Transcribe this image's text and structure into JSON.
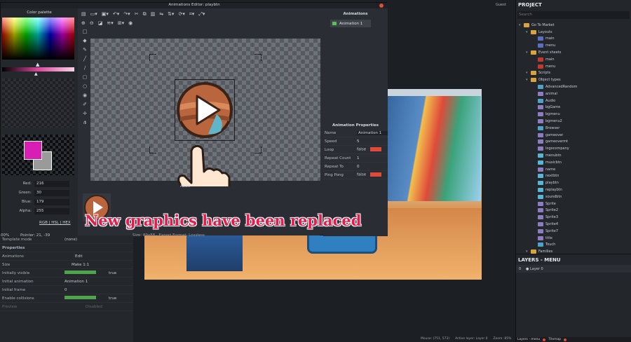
{
  "anim_editor": {
    "title": "Animations Editor: playbtn",
    "color_palette_title": "Color palette",
    "rgba": [
      {
        "label": "Red:",
        "value": "216"
      },
      {
        "label": "Green:",
        "value": "30"
      },
      {
        "label": "Blue:",
        "value": "179"
      },
      {
        "label": "Alpha:",
        "value": "255"
      }
    ],
    "color_modes": "RGB | HSL | HEX",
    "zoom_status": "00%",
    "pointer": "Pointer: 21, -39",
    "size_status": "Size: 89x88 · Export Format: Lossless",
    "frames_label": "Anim",
    "animations_title": "Animations",
    "animation_item": "Animation 1",
    "props_title": "Animation Properties",
    "props": [
      {
        "label": "Name",
        "value": "Animation 1"
      },
      {
        "label": "Speed",
        "value": "5"
      },
      {
        "label": "Loop",
        "value": "false"
      },
      {
        "label": "Repeat Count",
        "value": "1"
      },
      {
        "label": "Repeat To",
        "value": "0"
      },
      {
        "label": "Ping Pong",
        "value": "false"
      }
    ],
    "close_label": "×"
  },
  "caption": "New graphics have been replaced",
  "project": {
    "title": "PROJECT",
    "search_placeholder": "Search",
    "tree": [
      {
        "label": "Go To Market",
        "depth": 0,
        "type": "folder"
      },
      {
        "label": "Layouts",
        "depth": 1,
        "type": "folder"
      },
      {
        "label": "main",
        "depth": 2,
        "type": "layout"
      },
      {
        "label": "menu",
        "depth": 2,
        "type": "layout"
      },
      {
        "label": "Event sheets",
        "depth": 1,
        "type": "folder"
      },
      {
        "label": "main",
        "depth": 2,
        "type": "events"
      },
      {
        "label": "menu",
        "depth": 2,
        "type": "events"
      },
      {
        "label": "Scripts",
        "depth": 1,
        "type": "folder"
      },
      {
        "label": "Object types",
        "depth": 1,
        "type": "folder"
      },
      {
        "label": "AdvancedRandom",
        "depth": 2,
        "type": "plugin"
      },
      {
        "label": "animal",
        "depth": 2,
        "type": "sprite"
      },
      {
        "label": "Audio",
        "depth": 2,
        "type": "plugin"
      },
      {
        "label": "bgGame",
        "depth": 2,
        "type": "sprite"
      },
      {
        "label": "bgmenu",
        "depth": 2,
        "type": "sprite"
      },
      {
        "label": "bgmenu2",
        "depth": 2,
        "type": "sprite"
      },
      {
        "label": "Browser",
        "depth": 2,
        "type": "plugin"
      },
      {
        "label": "gameover",
        "depth": 2,
        "type": "sprite"
      },
      {
        "label": "gameovermt",
        "depth": 2,
        "type": "sprite"
      },
      {
        "label": "logocompany",
        "depth": 2,
        "type": "sprite"
      },
      {
        "label": "menubtn",
        "depth": 2,
        "type": "btn"
      },
      {
        "label": "musicbtn",
        "depth": 2,
        "type": "btn"
      },
      {
        "label": "name",
        "depth": 2,
        "type": "sprite"
      },
      {
        "label": "nextbtn",
        "depth": 2,
        "type": "btn"
      },
      {
        "label": "playbtn",
        "depth": 2,
        "type": "btn"
      },
      {
        "label": "replaybtn",
        "depth": 2,
        "type": "btn"
      },
      {
        "label": "soundbtn",
        "depth": 2,
        "type": "btn"
      },
      {
        "label": "Sprite",
        "depth": 2,
        "type": "sprite"
      },
      {
        "label": "Sprite2",
        "depth": 2,
        "type": "sprite"
      },
      {
        "label": "Sprite3",
        "depth": 2,
        "type": "sprite"
      },
      {
        "label": "Sprite4",
        "depth": 2,
        "type": "sprite"
      },
      {
        "label": "Sprite7",
        "depth": 2,
        "type": "sprite"
      },
      {
        "label": "title",
        "depth": 2,
        "type": "sprite"
      },
      {
        "label": "Touch",
        "depth": 2,
        "type": "plugin"
      },
      {
        "label": "Families",
        "depth": 1,
        "type": "folder"
      }
    ]
  },
  "layers": {
    "title": "LAYERS - MENU",
    "layer_index": "0",
    "layer_name": "Layer 0",
    "tabs": [
      "Layers - menu",
      "Tilemap"
    ]
  },
  "properties": {
    "rows": [
      {
        "label": "Template mode",
        "value": "(none)"
      },
      {
        "label": "Properties",
        "value": ""
      },
      {
        "label": "Animations",
        "value": "Edit"
      },
      {
        "label": "Size",
        "value": "Make 1:1"
      },
      {
        "label": "Initially visible",
        "value": "true"
      },
      {
        "label": "Initial animation",
        "value": "Animation 1"
      },
      {
        "label": "Initial frame",
        "value": "0"
      },
      {
        "label": "Enable collisions",
        "value": "true"
      },
      {
        "label": "Preview",
        "value": "Disabled"
      }
    ]
  },
  "statusbar": {
    "mouse": "Mouse: (751, 573)",
    "active_layer": "Active layer: Layer 0",
    "zoom": "Zoom: 85%"
  },
  "topbar_user": "Guest",
  "colors": {
    "primary": "#d81fb3",
    "secondary": "#9a9a9a",
    "toggle_red": "#e04a3a",
    "caption": "#e51d4d"
  }
}
